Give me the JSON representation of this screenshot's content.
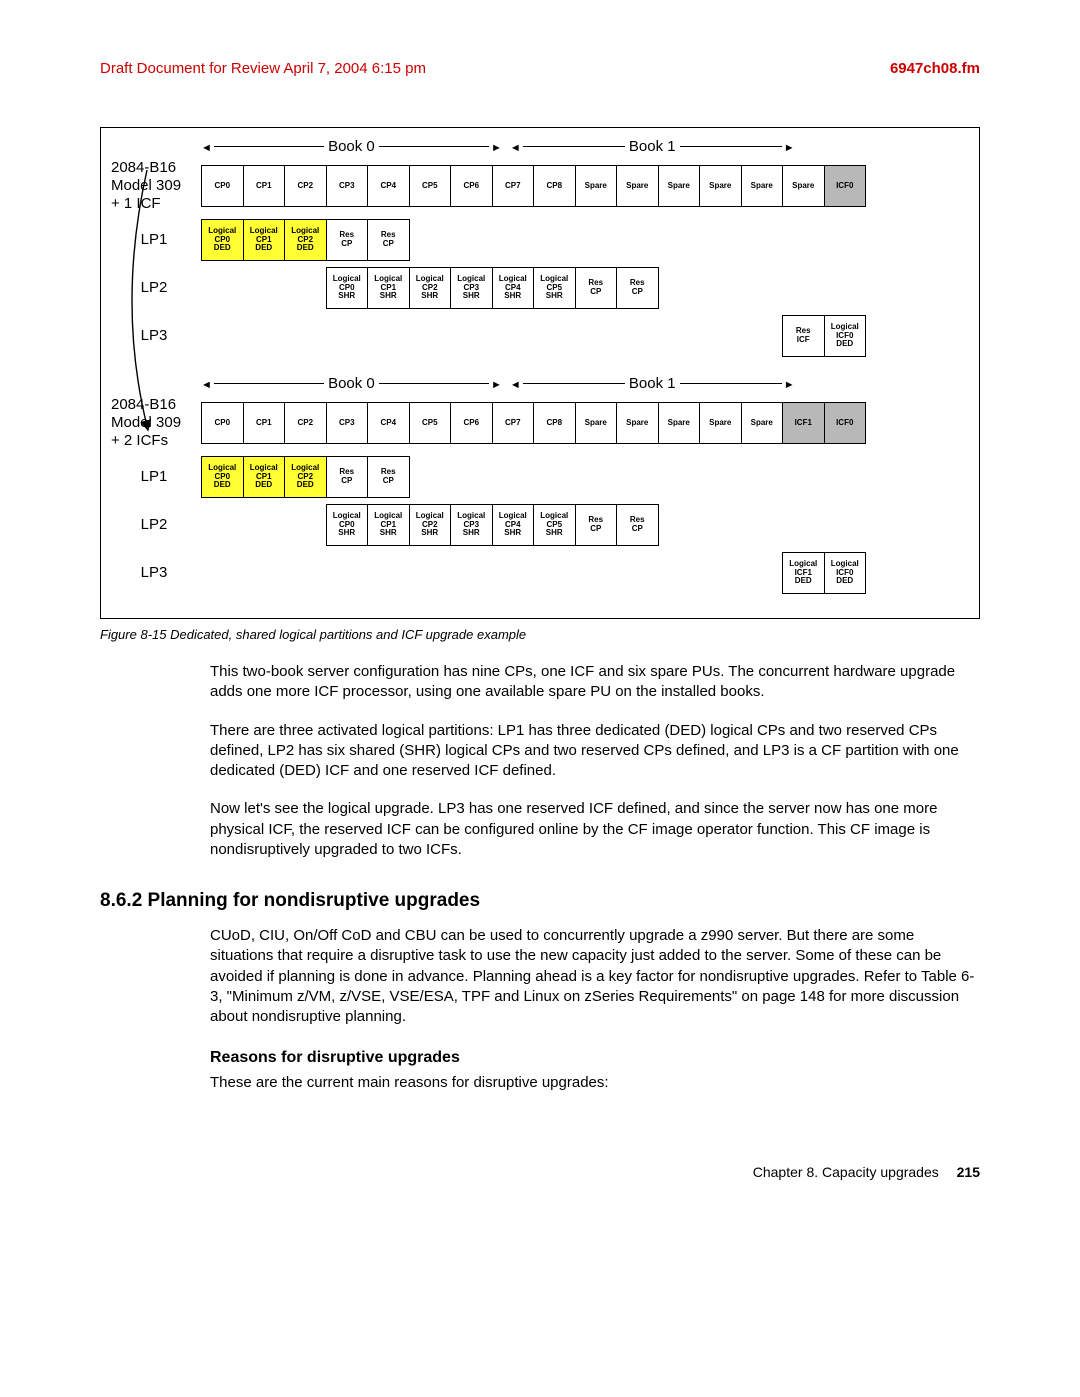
{
  "header": {
    "draft": "Draft Document for Review April 7, 2004 6:15 pm",
    "file": "6947ch08.fm"
  },
  "fig": {
    "book0": "Book 0",
    "book1": "Book 1",
    "config1_label": "2084-B16\nModel 309\n+ 1 ICF",
    "config2_label": "2084-B16\nModel 309\n+ 2 ICFs",
    "lp1": "LP1",
    "lp2": "LP2",
    "lp3": "LP3",
    "cp_row": [
      "CP0",
      "CP1",
      "CP2",
      "CP3",
      "CP4",
      "CP5",
      "CP6",
      "CP7",
      "CP8",
      "Spare",
      "Spare",
      "Spare",
      "Spare",
      "Spare",
      "Spare",
      "ICF0"
    ],
    "cp_row2": [
      "CP0",
      "CP1",
      "CP2",
      "CP3",
      "CP4",
      "CP5",
      "CP6",
      "CP7",
      "CP8",
      "Spare",
      "Spare",
      "Spare",
      "Spare",
      "Spare",
      "ICF1",
      "ICF0"
    ],
    "lp1_cells": [
      {
        "t": "Logical\nCP0\nDED",
        "c": "yellow"
      },
      {
        "t": "Logical\nCP1\nDED",
        "c": "yellow"
      },
      {
        "t": "Logical\nCP2\nDED",
        "c": "yellow"
      },
      {
        "t": "Res\nCP",
        "c": ""
      },
      {
        "t": "Res\nCP",
        "c": ""
      }
    ],
    "lp2_cells": [
      {
        "t": "Logical\nCP0\nSHR",
        "c": ""
      },
      {
        "t": "Logical\nCP1\nSHR",
        "c": ""
      },
      {
        "t": "Logical\nCP2\nSHR",
        "c": ""
      },
      {
        "t": "Logical\nCP3\nSHR",
        "c": ""
      },
      {
        "t": "Logical\nCP4\nSHR",
        "c": ""
      },
      {
        "t": "Logical\nCP5\nSHR",
        "c": ""
      },
      {
        "t": "Res\nCP",
        "c": ""
      },
      {
        "t": "Res\nCP",
        "c": ""
      }
    ],
    "lp3a_cells": [
      {
        "t": "Res\nICF",
        "c": ""
      },
      {
        "t": "Logical\nICF0\nDED",
        "c": ""
      }
    ],
    "lp3b_cells": [
      {
        "t": "Logical\nICF1\nDED",
        "c": ""
      },
      {
        "t": "Logical\nICF0\nDED",
        "c": ""
      }
    ],
    "caption": "Figure 8-15   Dedicated, shared logical partitions and ICF upgrade example"
  },
  "paras": {
    "p1": "This two-book server configuration has nine CPs, one ICF and six spare PUs. The concurrent hardware upgrade adds one more ICF processor, using one available spare PU on the installed books.",
    "p2": "There are three activated logical partitions: LP1 has three dedicated (DED) logical CPs and two reserved CPs defined, LP2 has six shared (SHR) logical CPs and two reserved CPs defined, and LP3 is a CF partition with one dedicated (DED) ICF and one reserved ICF defined.",
    "p3": "Now let's see the logical upgrade. LP3 has one reserved ICF defined, and since the server now has one more physical ICF, the reserved ICF can be configured online by the CF image operator function. This CF image is nondisruptively upgraded to two ICFs."
  },
  "section": {
    "num_title": "8.6.2  Planning for nondisruptive upgrades",
    "body": "CUoD, CIU, On/Off CoD and CBU can be used to concurrently upgrade a z990 server. But there are some situations that require a disruptive task to use the new capacity just added to the server. Some of these can be avoided if planning is done in advance. Planning ahead is a key factor for nondisruptive upgrades. Refer to Table 6-3, \"Minimum z/VM, z/VSE, VSE/ESA, TPF and Linux on zSeries Requirements\" on page 148 for more discussion about nondisruptive planning.",
    "sub": "Reasons for disruptive upgrades",
    "sub_body": "These are the current main reasons for disruptive upgrades:"
  },
  "footer": {
    "chapter": "Chapter 8. Capacity upgrades",
    "page": "215"
  }
}
